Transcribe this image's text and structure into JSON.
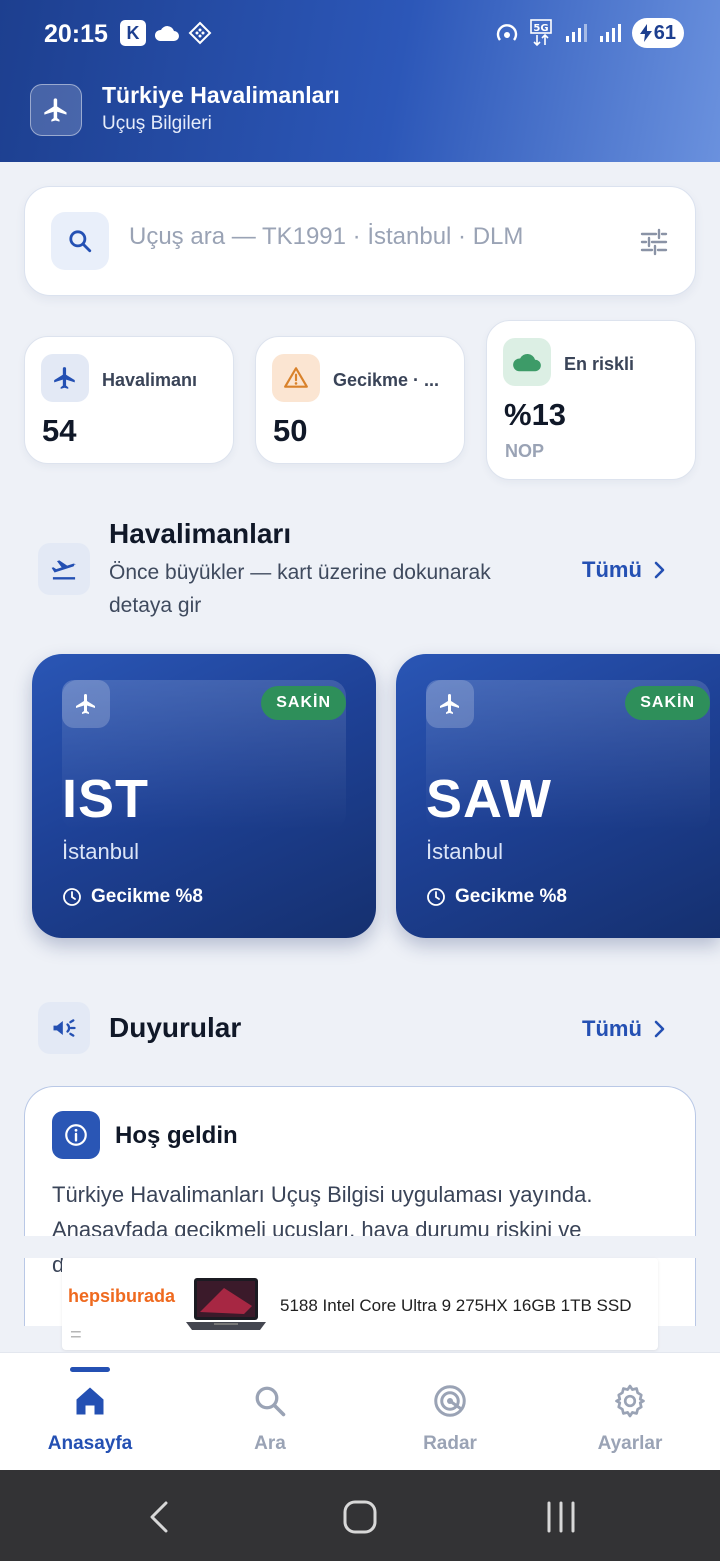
{
  "status_bar": {
    "time": "20:15",
    "k_badge": "K",
    "battery": "61"
  },
  "header": {
    "title": "Türkiye Havalimanları",
    "subtitle": "Uçuş Bilgileri"
  },
  "search": {
    "placeholder": "Uçuş ara — TK1991 · İstanbul · DLM"
  },
  "stats": [
    {
      "label": "Havalimanı",
      "value": "54"
    },
    {
      "label": "Gecikme · ...",
      "value": "50"
    },
    {
      "label": "En riskli",
      "value": "%13",
      "sub": "NOP"
    }
  ],
  "airports_section": {
    "title": "Havalimanları",
    "description": "Önce büyükler — kart üzerine dokunarak detaya gir",
    "see_all": "Tümü"
  },
  "airports": [
    {
      "code": "IST",
      "city": "İstanbul",
      "status": "SAKİN",
      "delay": "Gecikme %8"
    },
    {
      "code": "SAW",
      "city": "İstanbul",
      "status": "SAKİN",
      "delay": "Gecikme %8"
    }
  ],
  "announcements_section": {
    "title": "Duyurular",
    "see_all": "Tümü"
  },
  "announcement": {
    "title": "Hoş geldin",
    "body": "Türkiye Havalimanları Uçuş Bilgisi uygulaması yayında. Anasayfada gecikmeli uçuşları, hava durumu riskini ve duyuruları görebilirsin."
  },
  "ad": {
    "brand": "hepsiburada",
    "text": "5188 Intel Core Ultra 9 275HX 16GB 1TB SSD",
    "mark": "="
  },
  "nav": [
    {
      "label": "Anasayfa",
      "icon": "home-icon",
      "active": true
    },
    {
      "label": "Ara",
      "icon": "search-icon",
      "active": false
    },
    {
      "label": "Radar",
      "icon": "radar-icon",
      "active": false
    },
    {
      "label": "Ayarlar",
      "icon": "gear-icon",
      "active": false
    }
  ],
  "colors": {
    "primary": "#2450b3",
    "header_gradient_start": "#1d3f8f",
    "header_gradient_end": "#6a91de",
    "status_calm": "#2e8f5a",
    "warning": "#d9822b",
    "ad_brand": "#ef6a1f"
  }
}
